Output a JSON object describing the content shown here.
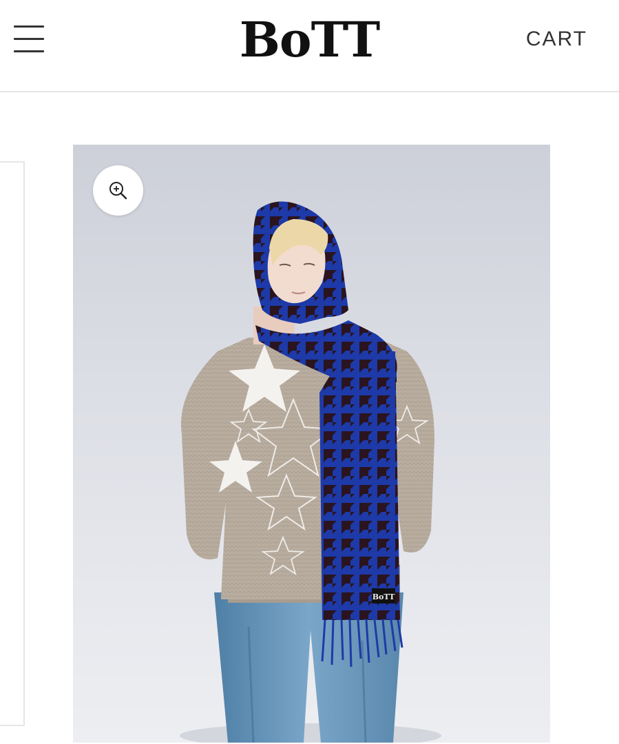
{
  "header": {
    "menu_icon": "hamburger-menu-icon",
    "logo_text": "BoTT",
    "cart_label": "CART"
  },
  "product": {
    "zoom_icon": "zoom-in-icon",
    "scarf_tag_text": "BoTT"
  },
  "colors": {
    "background": "#ffffff",
    "text": "#222222",
    "divider": "#e6e6e6",
    "scarf_blue": "#1d3aa8",
    "scarf_dark": "#2a1420",
    "sweater": "#b9ada0",
    "denim": "#6f9cbf"
  }
}
